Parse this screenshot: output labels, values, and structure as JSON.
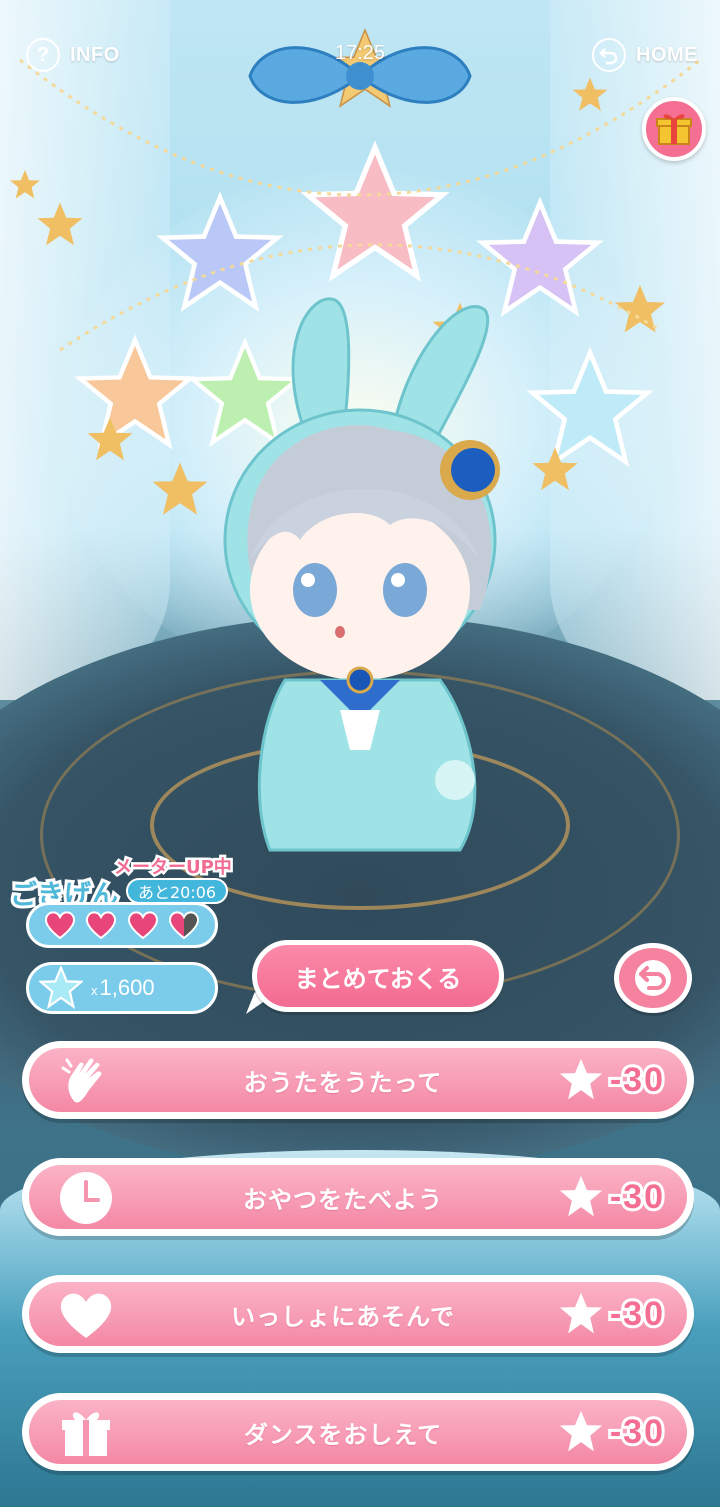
{
  "topbar": {
    "info_label": "INFO",
    "info_icon_glyph": "?",
    "time": "17:25",
    "home_label": "HOME"
  },
  "gift": {
    "icon": "gift-box-icon"
  },
  "mood": {
    "title": "ごきげん",
    "meter_up": "メーターUP中",
    "timer": "あと20:06",
    "hearts_filled": 3.5,
    "hearts_total": 4
  },
  "stars": {
    "prefix": "x",
    "count": "1,600"
  },
  "send_button": {
    "label": "まとめておくる"
  },
  "actions": [
    {
      "label": "おうたをうたって",
      "cost": "-30",
      "icon": "clap-hand-icon"
    },
    {
      "label": "おやつをたべよう",
      "cost": "-30",
      "icon": "clock-icon"
    },
    {
      "label": "いっしょにあそんで",
      "cost": "-30",
      "icon": "heart-icon"
    },
    {
      "label": "ダンスをおしえて",
      "cost": "-30",
      "icon": "gift-icon"
    }
  ],
  "colors": {
    "pink": "#f487a4",
    "blue": "#7bcbea",
    "heart": "#e8457a"
  }
}
